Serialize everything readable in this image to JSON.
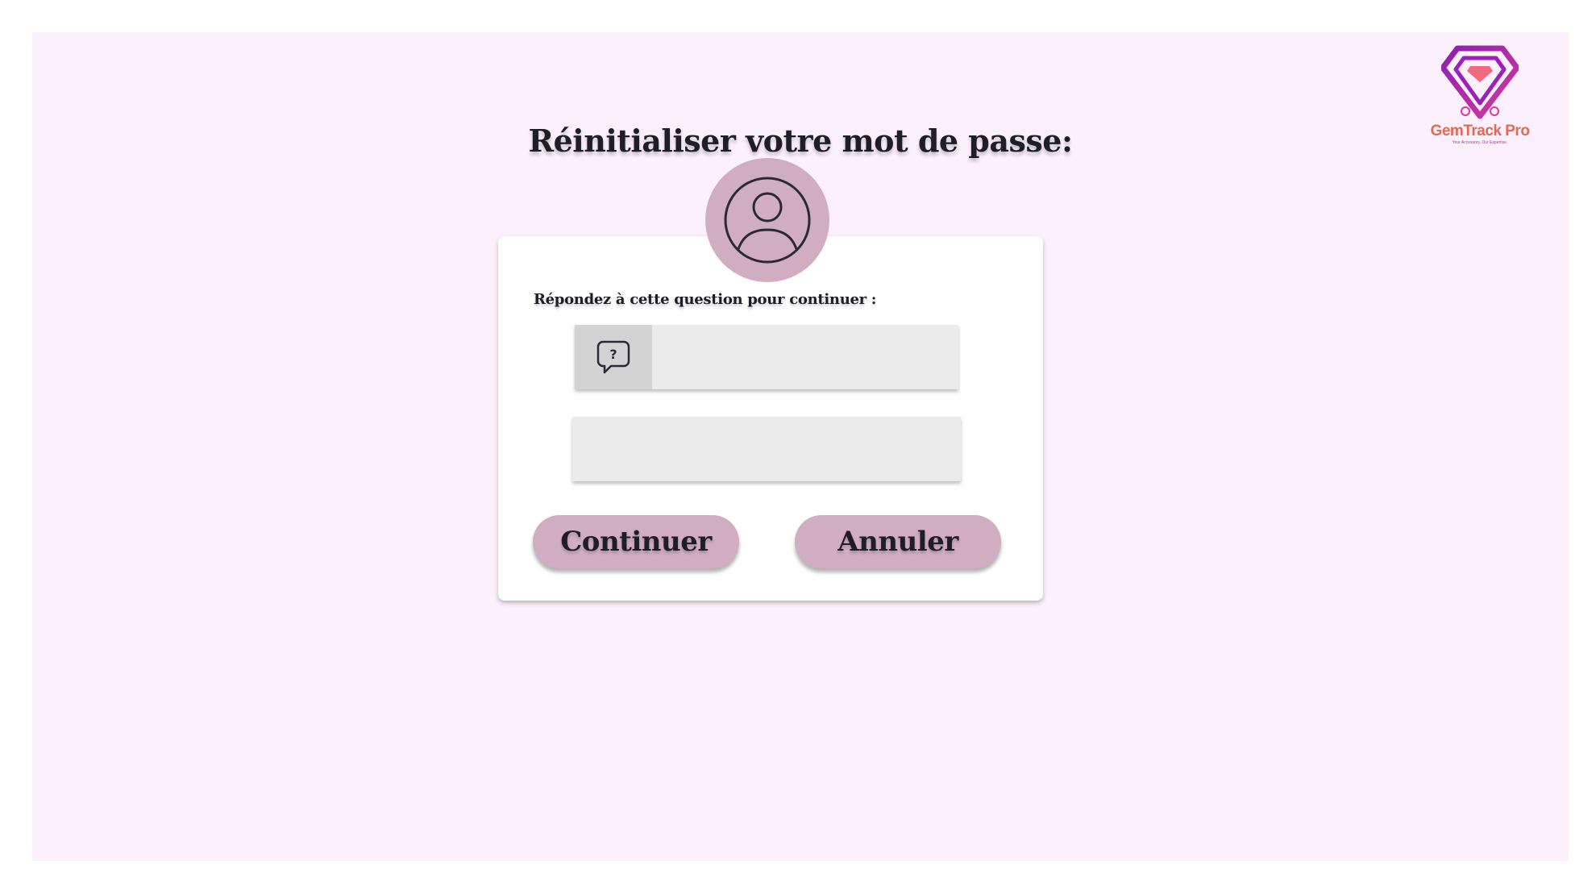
{
  "brand": {
    "name": "GemTrack Pro",
    "tagline": "Your Accessory, Our Expertise.",
    "logo_icon": "diamond-logo-icon"
  },
  "page": {
    "title": "Réinitialiser votre mot de passe:"
  },
  "form": {
    "prompt": "Répondez à cette question pour continuer   :",
    "question_field": {
      "value": "",
      "placeholder": "",
      "icon": "question-bubble-icon"
    },
    "answer_field": {
      "value": "",
      "placeholder": ""
    },
    "avatar_icon": "user-avatar-icon"
  },
  "buttons": {
    "continue_label": "Continuer",
    "cancel_label": "Annuler"
  },
  "colors": {
    "background": "#fcf0fc",
    "accent": "#d1adc2",
    "field": "#ebebeb",
    "text": "#1e1e26",
    "brand_text": "#e06a55",
    "logo_purple": "#9a22b8"
  }
}
